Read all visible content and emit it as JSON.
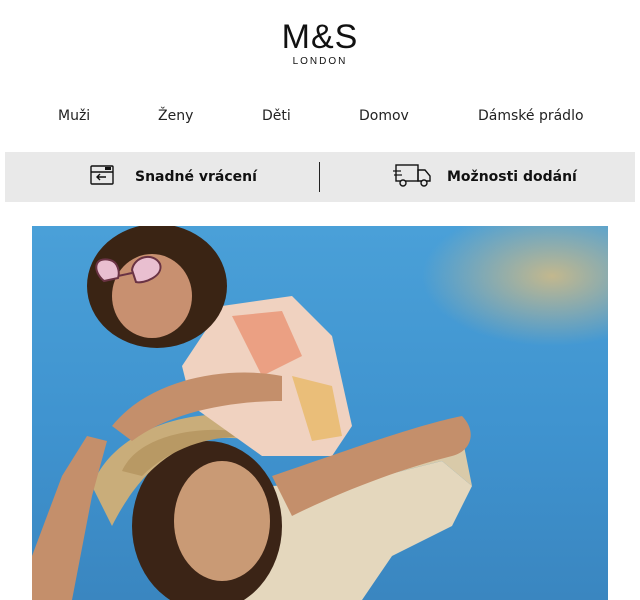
{
  "brand": {
    "name": "M&S",
    "sub": "LONDON"
  },
  "nav": [
    "Muži",
    "Ženy",
    "Děti",
    "Domov",
    "Dámské prádlo"
  ],
  "services": [
    {
      "label": "Snadné vrácení",
      "icon": "return-box-icon"
    },
    {
      "label": "Možnosti dodání",
      "icon": "delivery-truck-icon"
    }
  ],
  "colors": {
    "bar": "#e9e9e9",
    "sky": "#3f93cf",
    "text": "#111111"
  }
}
